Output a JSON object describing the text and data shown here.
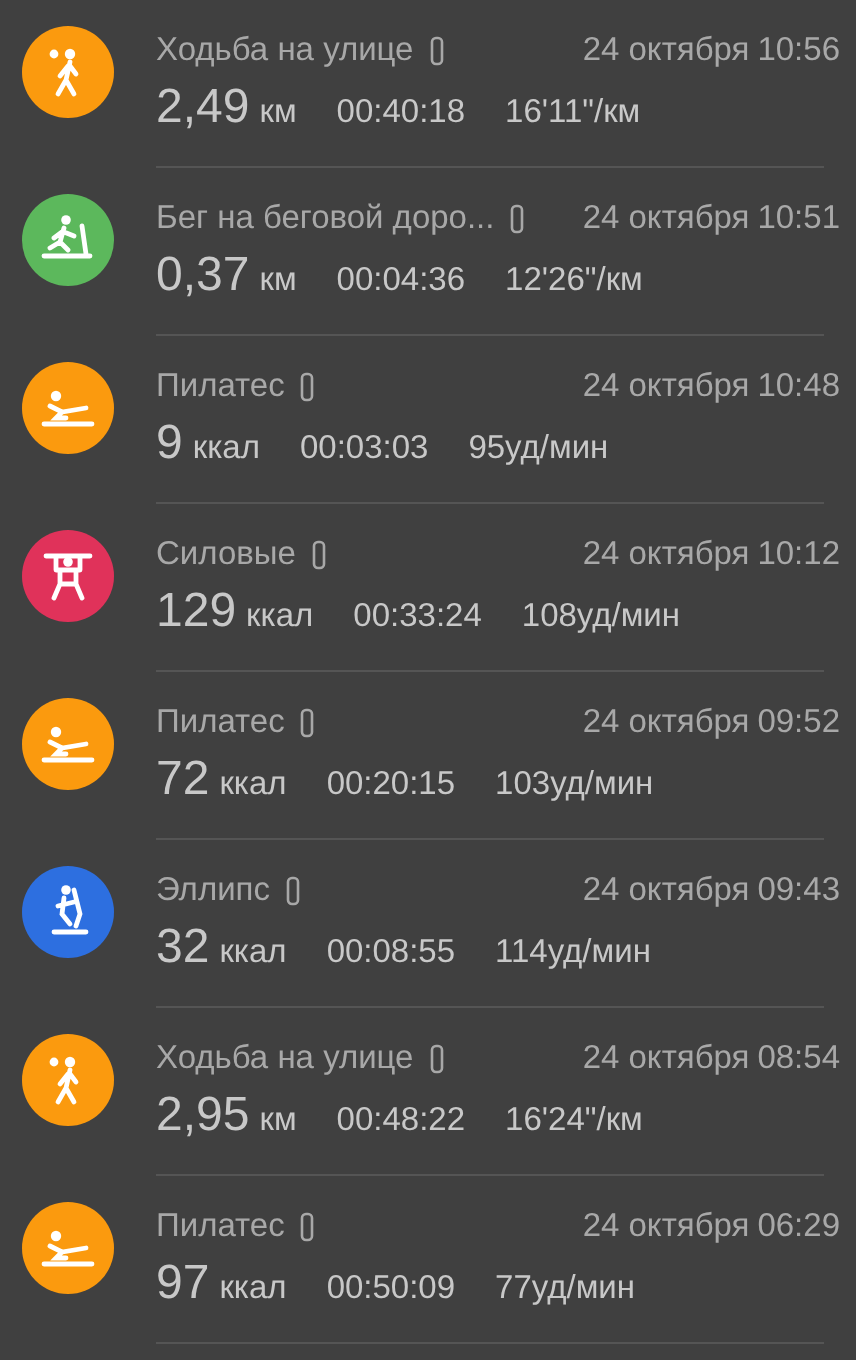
{
  "workouts": [
    {
      "kind": "walk",
      "color": "#fb9a0e",
      "title": "Ходьба на улице",
      "date": "24 октября",
      "time": "10:56",
      "value": "2,49",
      "unit": "км",
      "duration": "00:40:18",
      "extra": "16'11\"/км"
    },
    {
      "kind": "treadmill",
      "color": "#5cb85c",
      "title": "Бег на беговой доро...",
      "date": "24 октября",
      "time": "10:51",
      "value": "0,37",
      "unit": "км",
      "duration": "00:04:36",
      "extra": "12'26\"/км"
    },
    {
      "kind": "pilates",
      "color": "#fb9a0e",
      "title": "Пилатес",
      "date": "24 октября",
      "time": "10:48",
      "value": "9",
      "unit": "ккал",
      "duration": "00:03:03",
      "extra": "95уд/мин"
    },
    {
      "kind": "strength",
      "color": "#e0325a",
      "title": "Силовые",
      "date": "24 октября",
      "time": "10:12",
      "value": "129",
      "unit": "ккал",
      "duration": "00:33:24",
      "extra": "108уд/мин"
    },
    {
      "kind": "pilates",
      "color": "#fb9a0e",
      "title": "Пилатес",
      "date": "24 октября",
      "time": "09:52",
      "value": "72",
      "unit": "ккал",
      "duration": "00:20:15",
      "extra": "103уд/мин"
    },
    {
      "kind": "elliptical",
      "color": "#2d6fe0",
      "title": "Эллипс",
      "date": "24 октября",
      "time": "09:43",
      "value": "32",
      "unit": "ккал",
      "duration": "00:08:55",
      "extra": "114уд/мин"
    },
    {
      "kind": "walk",
      "color": "#fb9a0e",
      "title": "Ходьба на улице",
      "date": "24 октября",
      "time": "08:54",
      "value": "2,95",
      "unit": "км",
      "duration": "00:48:22",
      "extra": "16'24\"/км"
    },
    {
      "kind": "pilates",
      "color": "#fb9a0e",
      "title": "Пилатес",
      "date": "24 октября",
      "time": "06:29",
      "value": "97",
      "unit": "ккал",
      "duration": "00:50:09",
      "extra": "77уд/мин"
    }
  ]
}
